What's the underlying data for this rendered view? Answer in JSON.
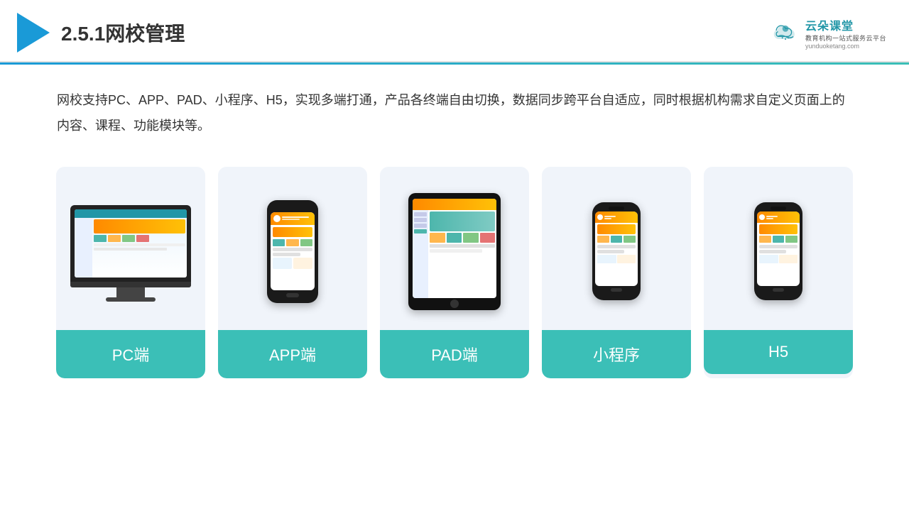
{
  "header": {
    "title": "2.5.1网校管理",
    "brand": {
      "name": "云朵课堂",
      "tagline": "教育机构一站式服务云平台",
      "url": "yunduoketang.com"
    }
  },
  "description": "网校支持PC、APP、PAD、小程序、H5，实现多端打通，产品各终端自由切换，数据同步跨平台自适应，同时根据机构需求自定义页面上的内容、课程、功能模块等。",
  "cards": [
    {
      "id": "pc",
      "label": "PC端"
    },
    {
      "id": "app",
      "label": "APP端"
    },
    {
      "id": "pad",
      "label": "PAD端"
    },
    {
      "id": "miniprogram",
      "label": "小程序"
    },
    {
      "id": "h5",
      "label": "H5"
    }
  ],
  "colors": {
    "accent": "#1a9ad7",
    "teal": "#3bbfb7",
    "brand": "#2196a7"
  }
}
